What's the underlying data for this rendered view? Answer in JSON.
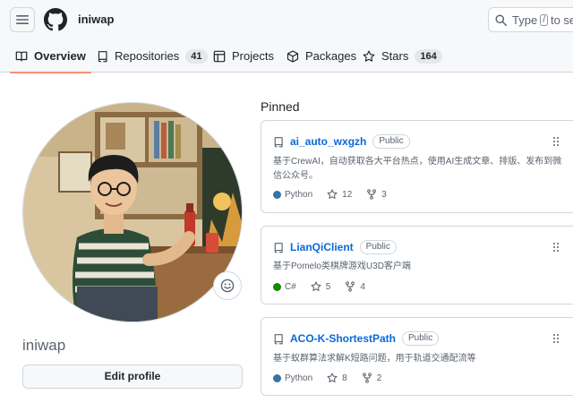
{
  "header": {
    "owner": "iniwap",
    "search_prefix": "Type",
    "search_key": "/",
    "search_suffix": "to search"
  },
  "tabs": [
    {
      "label": "Overview",
      "icon": "book-icon",
      "active": true
    },
    {
      "label": "Repositories",
      "icon": "repo-icon",
      "count": "41"
    },
    {
      "label": "Projects",
      "icon": "table-icon"
    },
    {
      "label": "Packages",
      "icon": "package-icon"
    },
    {
      "label": "Stars",
      "icon": "star-icon",
      "count": "164"
    }
  ],
  "profile": {
    "login": "iniwap",
    "edit_label": "Edit profile",
    "avatar": "illustrated-portrait"
  },
  "pinned": {
    "title": "Pinned",
    "repos": [
      {
        "name": "ai_auto_wxgzh",
        "visibility": "Public",
        "description": "基于CrewAI，自动获取各大平台热点，使用AI生成文章、排版、发布到微信公众号。",
        "language": "Python",
        "language_color": "#3572A5",
        "stars": "12",
        "forks": "3"
      },
      {
        "name": "LianQiClient",
        "visibility": "Public",
        "description": "基于Pomelo类棋牌游戏U3D客户端",
        "language": "C#",
        "language_color": "#178600",
        "stars": "5",
        "forks": "4"
      },
      {
        "name": "ACO-K-ShortestPath",
        "visibility": "Public",
        "description": "基于蚁群算法求解K短路问题，用于轨道交通配流等",
        "language": "Python",
        "language_color": "#3572A5",
        "stars": "8",
        "forks": "2"
      }
    ]
  }
}
